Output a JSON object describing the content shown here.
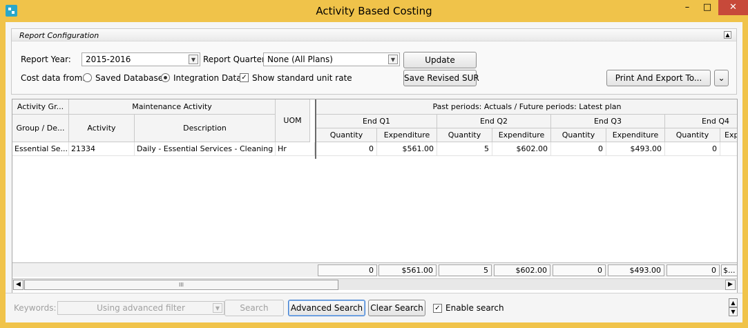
{
  "window": {
    "title": "Activity Based Costing",
    "min": "–",
    "max": "□",
    "close": "✕"
  },
  "config": {
    "panel_title": "Report Configuration",
    "report_year_label": "Report Year:",
    "report_year_value": "2015-2016",
    "report_quarter_label": "Report Quarter:",
    "report_quarter_value": "None (All Plans)",
    "update_button": "Update",
    "cost_data_label": "Cost data from:",
    "saved_database": "Saved Database",
    "integration_data": "Integration Data",
    "show_unit_rate": "Show standard unit rate",
    "save_sur_button": "Save Revised SUR",
    "print_export_button": "Print And Export To..."
  },
  "grid": {
    "h_activity_group": "Activity Gr...",
    "h_maintenance_activity": "Maintenance Activity",
    "h_past_periods": "Past periods: Actuals / Future periods: Latest plan",
    "h_group_desc": "Group / De...",
    "h_activity": "Activity",
    "h_description": "Description",
    "h_uom": "UOM",
    "quarters": [
      "End Q1",
      "End Q2",
      "End Q3",
      "End Q4"
    ],
    "quantity": "Quantity",
    "expenditure": "Expenditure",
    "expenditure_cut": "Expe",
    "row": {
      "group": "Essential Se...",
      "activity": "21334",
      "description": "Daily - Essential Services - Cleaning",
      "uom": "Hr",
      "q1_qty": "0",
      "q1_exp": "$561.00",
      "q2_qty": "5",
      "q2_exp": "$602.00",
      "q3_qty": "0",
      "q3_exp": "$493.00",
      "q4_qty": "0"
    },
    "totals": {
      "q1_qty": "0",
      "q1_exp": "$561.00",
      "q2_qty": "5",
      "q2_exp": "$602.00",
      "q3_qty": "0",
      "q3_exp": "$493.00",
      "q4_qty": "0",
      "q4_exp": "$..."
    },
    "scroll_thumb": "III"
  },
  "search": {
    "keywords_label": "Keywords:",
    "keywords_value": "Using advanced filter",
    "search_button": "Search",
    "advanced_button": "Advanced Search",
    "clear_button": "Clear Search",
    "enable_label": "Enable search"
  }
}
